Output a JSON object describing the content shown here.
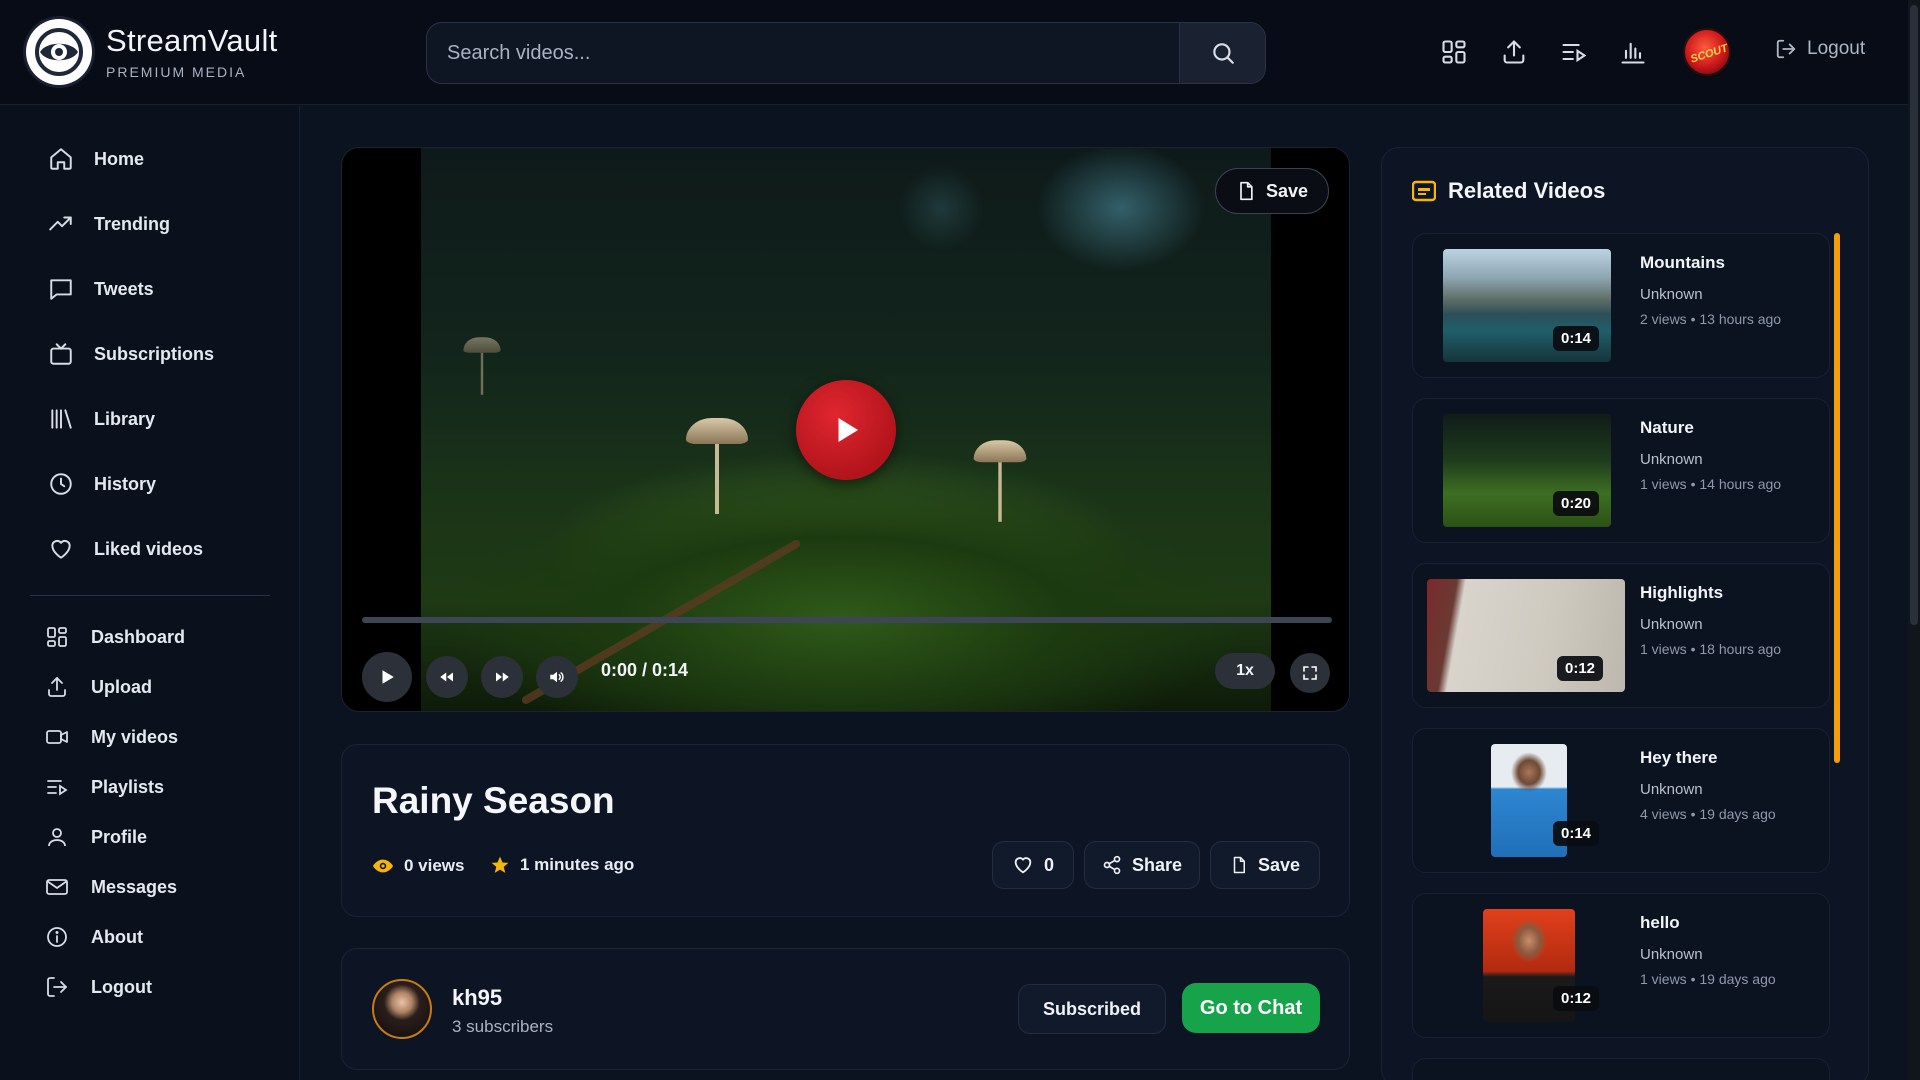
{
  "brand": {
    "name": "StreamVault",
    "tagline": "PREMIUM MEDIA"
  },
  "search": {
    "placeholder": "Search videos..."
  },
  "header": {
    "logout_label": "Logout"
  },
  "sidebar": {
    "primary": [
      {
        "label": "Home",
        "icon": "home-icon"
      },
      {
        "label": "Trending",
        "icon": "trending-icon"
      },
      {
        "label": "Tweets",
        "icon": "chat-icon"
      },
      {
        "label": "Subscriptions",
        "icon": "tv-icon"
      },
      {
        "label": "Library",
        "icon": "library-icon"
      },
      {
        "label": "History",
        "icon": "clock-icon"
      },
      {
        "label": "Liked videos",
        "icon": "heart-icon"
      }
    ],
    "secondary": [
      {
        "label": "Dashboard",
        "icon": "dashboard-icon"
      },
      {
        "label": "Upload",
        "icon": "upload-icon"
      },
      {
        "label": "My videos",
        "icon": "video-camera-icon"
      },
      {
        "label": "Playlists",
        "icon": "playlist-icon"
      },
      {
        "label": "Profile",
        "icon": "user-icon"
      },
      {
        "label": "Messages",
        "icon": "mail-icon"
      },
      {
        "label": "About",
        "icon": "info-icon"
      },
      {
        "label": "Logout",
        "icon": "logout-icon"
      }
    ]
  },
  "player": {
    "save_label": "Save",
    "time": "0:00 / 0:14",
    "speed": "1x",
    "progress": 0
  },
  "video": {
    "title": "Rainy Season",
    "views": "0 views",
    "uploaded": "1 minutes ago",
    "likes": "0",
    "share_label": "Share",
    "save_label": "Save"
  },
  "channel": {
    "name": "kh95",
    "subscribers": "3 subscribers",
    "subscribed_label": "Subscribed",
    "chat_label": "Go to Chat"
  },
  "related": {
    "heading": "Related Videos",
    "items": [
      {
        "title": "Mountains",
        "channel": "Unknown",
        "meta": "2 views  •  13 hours ago",
        "duration": "0:14"
      },
      {
        "title": "Nature",
        "channel": "Unknown",
        "meta": "1 views  •  14 hours ago",
        "duration": "0:20"
      },
      {
        "title": "Highlights",
        "channel": "Unknown",
        "meta": "1 views  •  18 hours ago",
        "duration": "0:12"
      },
      {
        "title": "Hey there",
        "channel": "Unknown",
        "meta": "4 views  •  19 days ago",
        "duration": "0:14"
      },
      {
        "title": "hello",
        "channel": "Unknown",
        "meta": "1 views  •  19 days ago",
        "duration": "0:12"
      }
    ]
  },
  "colors": {
    "accent": "#e0262f",
    "chat": "#16a34a",
    "highlight": "#f59e0b"
  }
}
